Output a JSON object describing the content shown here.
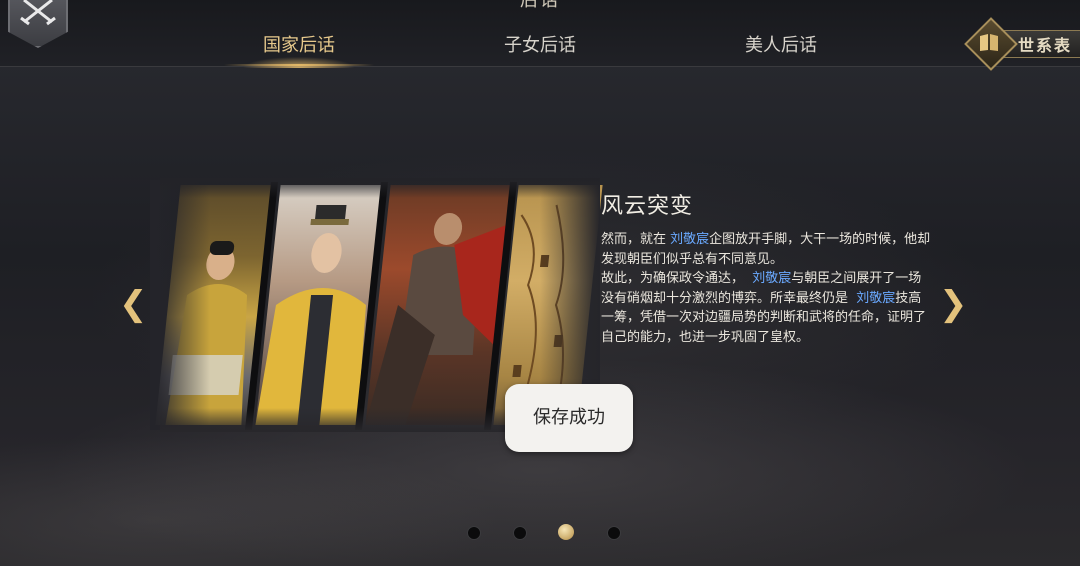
{
  "header": {
    "title": "后话"
  },
  "tabs": [
    {
      "label": "国家后话",
      "active": true
    },
    {
      "label": "子女后话",
      "active": false
    },
    {
      "label": "美人后话",
      "active": false
    }
  ],
  "lineage_button": {
    "label": "世系表"
  },
  "story": {
    "title": "风云突变",
    "p1": {
      "a": "然而，就在",
      "name": "刘敬宸",
      "b": "企图放开手脚，大干一场的时候，他却发现朝臣们似乎总有不同意见。"
    },
    "p2": {
      "a": "故此，为确保政令通达，",
      "name1": "刘敬宸",
      "b": "与朝臣之间展开了一场没有硝烟却十分激烈的博弈。所幸最终仍是",
      "name2": "刘敬宸",
      "c": "技高一筹，凭借一次对边疆局势的判断和武将的任命，证明了自己的能力，也进一步巩固了皇权。"
    }
  },
  "toast": {
    "text": "保存成功"
  },
  "navigation": {
    "prev_icon": "chevron-left-icon",
    "next_icon": "chevron-right-icon",
    "prev_glyph": "❮",
    "next_glyph": "❯"
  },
  "pagination": {
    "total": 4,
    "current": 3
  },
  "colors": {
    "accent_gold": "#e2b767",
    "name_highlight": "#6aa9ff"
  }
}
